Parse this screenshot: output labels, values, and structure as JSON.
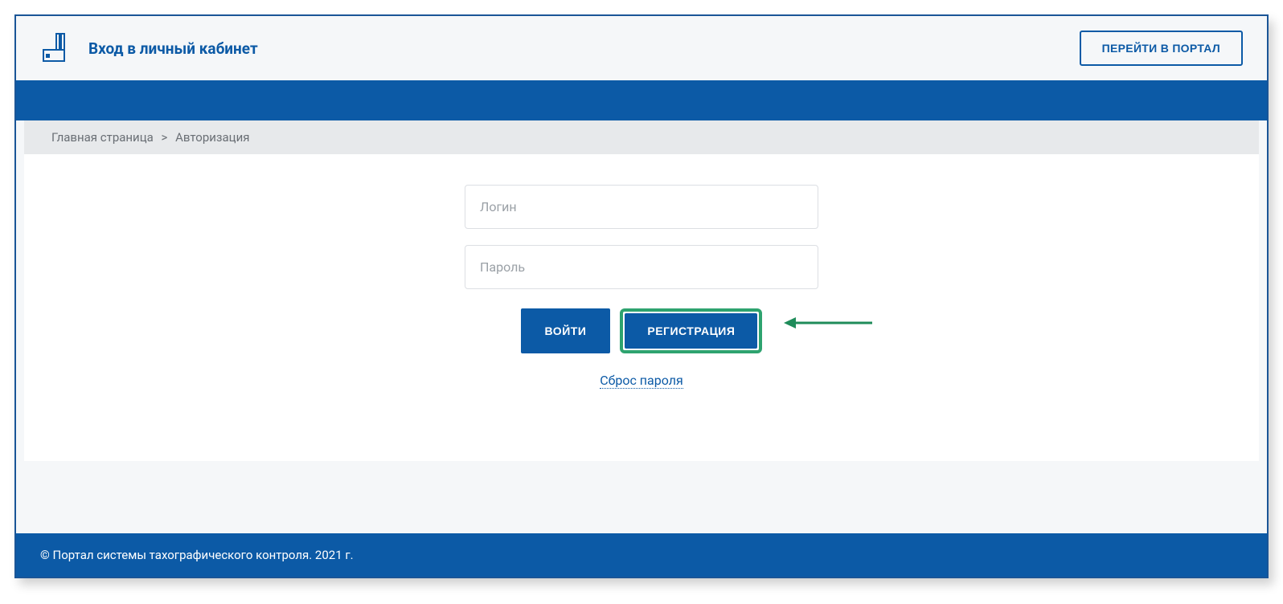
{
  "header": {
    "title": "Вход в личный кабинет",
    "portal_button": "ПЕРЕЙТИ В ПОРТАЛ"
  },
  "breadcrumb": {
    "home": "Главная страница",
    "separator": ">",
    "current": "Авторизация"
  },
  "form": {
    "login_placeholder": "Логин",
    "password_placeholder": "Пароль",
    "login_button": "ВОЙТИ",
    "register_button": "РЕГИСТРАЦИЯ",
    "reset_link": "Сброс пароля"
  },
  "footer": {
    "copyright": "© Портал системы тахографического контроля. 2021 г."
  },
  "colors": {
    "primary": "#0c5aa6",
    "highlight": "#2ea36f"
  }
}
